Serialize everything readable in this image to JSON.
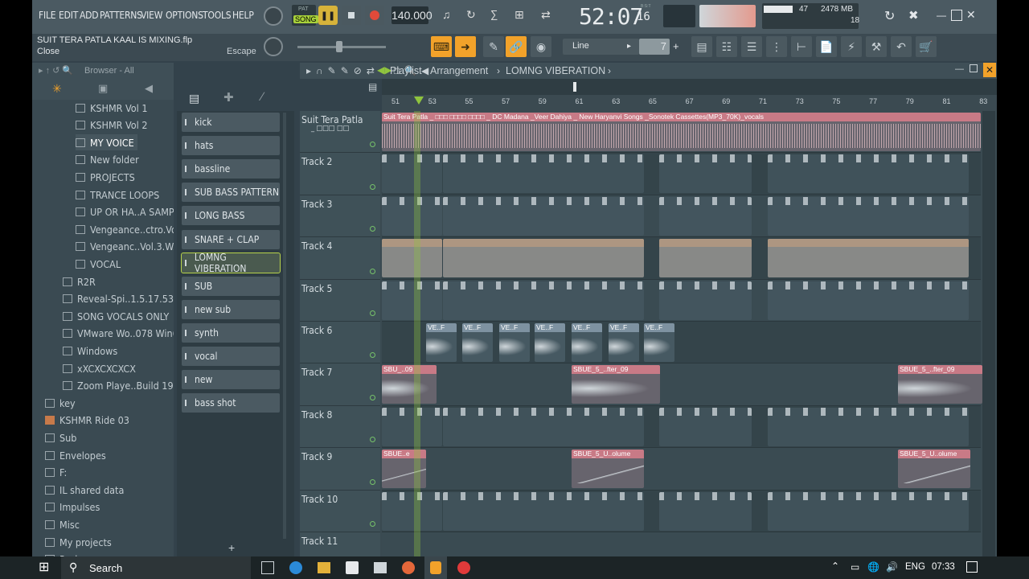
{
  "menu": [
    "FILE",
    "EDIT",
    "ADD",
    "PATTERNS",
    "VIEW",
    "OPTIONS",
    "TOOLS",
    "HELP"
  ],
  "file_title": "SUIT TERA PATLA KAAL IS MIXING.flp",
  "hint_left": "Close",
  "hint_right": "Escape",
  "transport": {
    "pat_label": "PAT",
    "song_label": "SONG",
    "tempo": "140.000",
    "time": "52:07",
    "time_sub": "16",
    "bst": "B:S:T"
  },
  "monitor": {
    "cpu": "47",
    "mem": "2478 MB",
    "poly": "18"
  },
  "snap_label": "Line",
  "step_value": "7",
  "browser": {
    "title": "Browser - All",
    "items": [
      {
        "label": "KSHMR Vol 1",
        "indent": 2
      },
      {
        "label": "KSHMR Vol 2",
        "indent": 2
      },
      {
        "label": "MY VOICE",
        "indent": 2,
        "active": true
      },
      {
        "label": "New folder",
        "indent": 2
      },
      {
        "label": "PROJECTS",
        "indent": 2
      },
      {
        "label": "TRANCE LOOPS",
        "indent": 2
      },
      {
        "label": "UP OR HA..A SAMPLE",
        "indent": 2
      },
      {
        "label": "Vengeance..ctro.Vol.2",
        "indent": 2
      },
      {
        "label": "Vengeanc..Vol.3.WAV",
        "indent": 2
      },
      {
        "label": "VOCAL",
        "indent": 2
      },
      {
        "label": "R2R",
        "indent": 1
      },
      {
        "label": "Reveal-Spi..1.5.17.5324",
        "indent": 1
      },
      {
        "label": "SONG VOCALS ONLY",
        "indent": 1
      },
      {
        "label": "VMware Wo..078 Win64",
        "indent": 1
      },
      {
        "label": "Windows",
        "indent": 1
      },
      {
        "label": "xXCXCXCXCX",
        "indent": 1
      },
      {
        "label": "Zoom Playe..Build 1950",
        "indent": 1
      },
      {
        "label": "key",
        "indent": 0
      },
      {
        "label": "KSHMR Ride 03",
        "indent": 0,
        "filled": true
      },
      {
        "label": "Sub",
        "indent": 0
      },
      {
        "label": "Envelopes",
        "indent": 0
      },
      {
        "label": "F:",
        "indent": 0
      },
      {
        "label": "IL shared data",
        "indent": 0
      },
      {
        "label": "Impulses",
        "indent": 0
      },
      {
        "label": "Misc",
        "indent": 0
      },
      {
        "label": "My projects",
        "indent": 0
      },
      {
        "label": "Packs",
        "indent": 0
      }
    ]
  },
  "patterns": [
    {
      "label": "kick"
    },
    {
      "label": "hats"
    },
    {
      "label": "bassline"
    },
    {
      "label": "SUB BASS PATTERN"
    },
    {
      "label": "LONG BASS"
    },
    {
      "label": "SNARE + CLAP"
    },
    {
      "label": "LOMNG VIBERATION",
      "selected": true
    },
    {
      "label": "SUB"
    },
    {
      "label": "new sub"
    },
    {
      "label": "synth"
    },
    {
      "label": "vocal"
    },
    {
      "label": "new"
    },
    {
      "label": "bass shot"
    }
  ],
  "playlist": {
    "title": "Playlist - Arrangement",
    "pattern": "LOMNG VIBERATION",
    "bars": [
      "51",
      "53",
      "55",
      "57",
      "59",
      "61",
      "63",
      "65",
      "67",
      "69",
      "71",
      "73",
      "75",
      "77",
      "79",
      "81",
      "83"
    ],
    "tracks": [
      {
        "name": "Suit Tera Patla",
        "sub": "_ □□□ □□",
        "clips": [
          {
            "label": "Suit Tera Patla _ □□□ □□□□ □□□□ _ DC Madana _Veer Dahiya _ New Haryanvi Songs _Sonotek Cassettes(MP3_70K)_vocals",
            "color": "pink"
          }
        ]
      },
      {
        "name": "Track 2",
        "clips": []
      },
      {
        "name": "Track 3",
        "clips": []
      },
      {
        "name": "Track 4",
        "clips": []
      },
      {
        "name": "Track 5",
        "clips": []
      },
      {
        "name": "Track 6",
        "clips": [
          {
            "label": "VE..F"
          },
          {
            "label": "VE..F"
          },
          {
            "label": "VE..F"
          },
          {
            "label": "VE..F"
          },
          {
            "label": "VE..F"
          },
          {
            "label": "VE..F"
          },
          {
            "label": "VE..F"
          }
        ]
      },
      {
        "name": "Track 7",
        "clips": [
          {
            "label": "SBU_..09"
          },
          {
            "label": "SBUE_5_..fter_09"
          },
          {
            "label": "SBUE_5_..fter_09"
          }
        ]
      },
      {
        "name": "Track 8",
        "clips": []
      },
      {
        "name": "Track 9",
        "clips": [
          {
            "label": "SBUE..e"
          },
          {
            "label": "SBUE_5_U..olume"
          },
          {
            "label": "SBUE_5_U..olume"
          }
        ]
      },
      {
        "name": "Track 10",
        "clips": []
      },
      {
        "name": "Track 11",
        "clips": []
      }
    ]
  },
  "taskbar": {
    "search": "Search",
    "lang": "ENG",
    "clock": "07:33"
  },
  "colors": {
    "accent": "#f2a22a",
    "bg": "#33424b",
    "selected": "#b7d24a"
  }
}
